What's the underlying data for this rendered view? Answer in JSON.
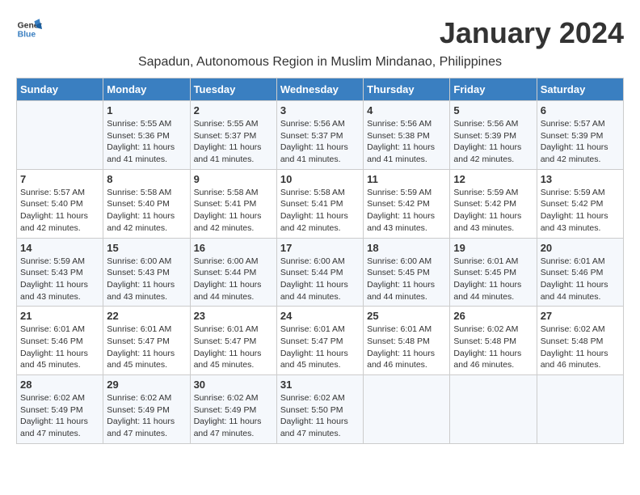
{
  "header": {
    "logo_line1": "General",
    "logo_line2": "Blue",
    "month_title": "January 2024",
    "subtitle": "Sapadun, Autonomous Region in Muslim Mindanao, Philippines"
  },
  "weekdays": [
    "Sunday",
    "Monday",
    "Tuesday",
    "Wednesday",
    "Thursday",
    "Friday",
    "Saturday"
  ],
  "weeks": [
    [
      {
        "day": "",
        "info": ""
      },
      {
        "day": "1",
        "info": "Sunrise: 5:55 AM\nSunset: 5:36 PM\nDaylight: 11 hours\nand 41 minutes."
      },
      {
        "day": "2",
        "info": "Sunrise: 5:55 AM\nSunset: 5:37 PM\nDaylight: 11 hours\nand 41 minutes."
      },
      {
        "day": "3",
        "info": "Sunrise: 5:56 AM\nSunset: 5:37 PM\nDaylight: 11 hours\nand 41 minutes."
      },
      {
        "day": "4",
        "info": "Sunrise: 5:56 AM\nSunset: 5:38 PM\nDaylight: 11 hours\nand 41 minutes."
      },
      {
        "day": "5",
        "info": "Sunrise: 5:56 AM\nSunset: 5:39 PM\nDaylight: 11 hours\nand 42 minutes."
      },
      {
        "day": "6",
        "info": "Sunrise: 5:57 AM\nSunset: 5:39 PM\nDaylight: 11 hours\nand 42 minutes."
      }
    ],
    [
      {
        "day": "7",
        "info": "Sunrise: 5:57 AM\nSunset: 5:40 PM\nDaylight: 11 hours\nand 42 minutes."
      },
      {
        "day": "8",
        "info": "Sunrise: 5:58 AM\nSunset: 5:40 PM\nDaylight: 11 hours\nand 42 minutes."
      },
      {
        "day": "9",
        "info": "Sunrise: 5:58 AM\nSunset: 5:41 PM\nDaylight: 11 hours\nand 42 minutes."
      },
      {
        "day": "10",
        "info": "Sunrise: 5:58 AM\nSunset: 5:41 PM\nDaylight: 11 hours\nand 42 minutes."
      },
      {
        "day": "11",
        "info": "Sunrise: 5:59 AM\nSunset: 5:42 PM\nDaylight: 11 hours\nand 43 minutes."
      },
      {
        "day": "12",
        "info": "Sunrise: 5:59 AM\nSunset: 5:42 PM\nDaylight: 11 hours\nand 43 minutes."
      },
      {
        "day": "13",
        "info": "Sunrise: 5:59 AM\nSunset: 5:42 PM\nDaylight: 11 hours\nand 43 minutes."
      }
    ],
    [
      {
        "day": "14",
        "info": "Sunrise: 5:59 AM\nSunset: 5:43 PM\nDaylight: 11 hours\nand 43 minutes."
      },
      {
        "day": "15",
        "info": "Sunrise: 6:00 AM\nSunset: 5:43 PM\nDaylight: 11 hours\nand 43 minutes."
      },
      {
        "day": "16",
        "info": "Sunrise: 6:00 AM\nSunset: 5:44 PM\nDaylight: 11 hours\nand 44 minutes."
      },
      {
        "day": "17",
        "info": "Sunrise: 6:00 AM\nSunset: 5:44 PM\nDaylight: 11 hours\nand 44 minutes."
      },
      {
        "day": "18",
        "info": "Sunrise: 6:00 AM\nSunset: 5:45 PM\nDaylight: 11 hours\nand 44 minutes."
      },
      {
        "day": "19",
        "info": "Sunrise: 6:01 AM\nSunset: 5:45 PM\nDaylight: 11 hours\nand 44 minutes."
      },
      {
        "day": "20",
        "info": "Sunrise: 6:01 AM\nSunset: 5:46 PM\nDaylight: 11 hours\nand 44 minutes."
      }
    ],
    [
      {
        "day": "21",
        "info": "Sunrise: 6:01 AM\nSunset: 5:46 PM\nDaylight: 11 hours\nand 45 minutes."
      },
      {
        "day": "22",
        "info": "Sunrise: 6:01 AM\nSunset: 5:47 PM\nDaylight: 11 hours\nand 45 minutes."
      },
      {
        "day": "23",
        "info": "Sunrise: 6:01 AM\nSunset: 5:47 PM\nDaylight: 11 hours\nand 45 minutes."
      },
      {
        "day": "24",
        "info": "Sunrise: 6:01 AM\nSunset: 5:47 PM\nDaylight: 11 hours\nand 45 minutes."
      },
      {
        "day": "25",
        "info": "Sunrise: 6:01 AM\nSunset: 5:48 PM\nDaylight: 11 hours\nand 46 minutes."
      },
      {
        "day": "26",
        "info": "Sunrise: 6:02 AM\nSunset: 5:48 PM\nDaylight: 11 hours\nand 46 minutes."
      },
      {
        "day": "27",
        "info": "Sunrise: 6:02 AM\nSunset: 5:48 PM\nDaylight: 11 hours\nand 46 minutes."
      }
    ],
    [
      {
        "day": "28",
        "info": "Sunrise: 6:02 AM\nSunset: 5:49 PM\nDaylight: 11 hours\nand 47 minutes."
      },
      {
        "day": "29",
        "info": "Sunrise: 6:02 AM\nSunset: 5:49 PM\nDaylight: 11 hours\nand 47 minutes."
      },
      {
        "day": "30",
        "info": "Sunrise: 6:02 AM\nSunset: 5:49 PM\nDaylight: 11 hours\nand 47 minutes."
      },
      {
        "day": "31",
        "info": "Sunrise: 6:02 AM\nSunset: 5:50 PM\nDaylight: 11 hours\nand 47 minutes."
      },
      {
        "day": "",
        "info": ""
      },
      {
        "day": "",
        "info": ""
      },
      {
        "day": "",
        "info": ""
      }
    ]
  ]
}
